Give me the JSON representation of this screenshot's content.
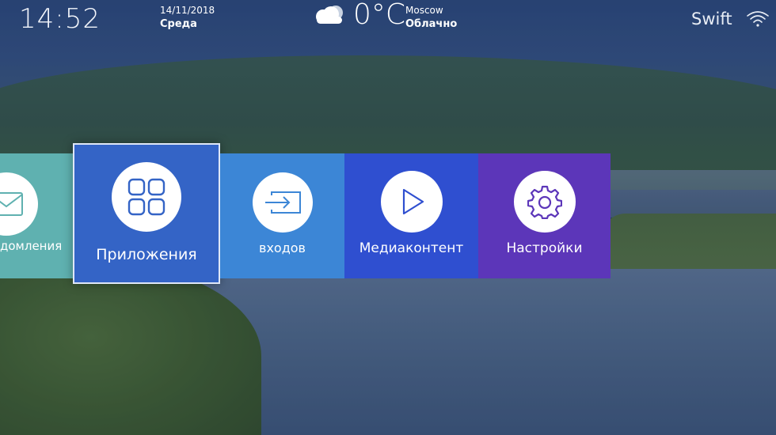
{
  "status": {
    "time": "14:52",
    "date": "14/11/2018",
    "day_of_week": "Среда",
    "temperature": "0°C",
    "city": "Moscow",
    "condition": "Облачно",
    "network_name": "Swift"
  },
  "icons": {
    "weather": "cloud-icon",
    "wifi": "wifi-icon"
  },
  "menu": {
    "tiles": [
      {
        "label": "домления",
        "icon": "mail-icon",
        "color": "#5fb1b0"
      },
      {
        "label": "Приложения",
        "icon": "apps-grid-icon",
        "color": "#3464c6",
        "focused": true
      },
      {
        "label": "входов",
        "icon": "input-source-icon",
        "color": "#3c86d6"
      },
      {
        "label": "Медиаконтент",
        "icon": "play-icon",
        "color": "#2f4fd0"
      },
      {
        "label": "Настройки",
        "icon": "gear-icon",
        "color": "#5c36b9"
      }
    ]
  }
}
